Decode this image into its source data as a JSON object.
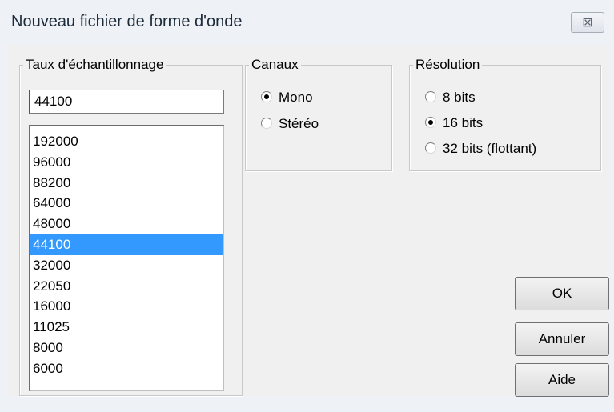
{
  "window": {
    "title": "Nouveau fichier de forme d'onde",
    "close_glyph": "⊠"
  },
  "sample_rate": {
    "legend": "Taux d'échantillonnage",
    "input_value": "44100",
    "items": [
      "192000",
      "96000",
      "88200",
      "64000",
      "48000",
      "44100",
      "32000",
      "22050",
      "16000",
      "11025",
      "8000",
      "6000"
    ],
    "selected_index": 5
  },
  "channels": {
    "legend": "Canaux",
    "options": [
      {
        "label": "Mono",
        "checked": true
      },
      {
        "label": "Stéréo",
        "checked": false
      }
    ]
  },
  "resolution": {
    "legend": "Résolution",
    "options": [
      {
        "label": "8 bits",
        "checked": false
      },
      {
        "label": "16 bits",
        "checked": true
      },
      {
        "label": "32 bits (flottant)",
        "checked": false
      }
    ]
  },
  "buttons": {
    "ok": "OK",
    "cancel": "Annuler",
    "help": "Aide"
  },
  "colors": {
    "selection": "#3399ff",
    "titlebar": "#eef1f6",
    "client": "#f0f0f0"
  }
}
